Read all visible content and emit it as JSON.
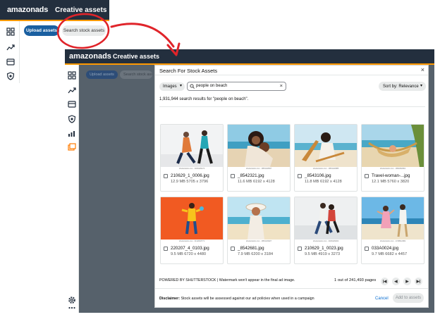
{
  "top_app": {
    "logo": "amazonads",
    "title": "Creative assets",
    "upload_label": "Upload assets",
    "search_label": "Search stock assets"
  },
  "big_app": {
    "logo": "amazonads",
    "title": "Creative assets",
    "upload_label": "Upload assets",
    "search_label": "Search stock assets"
  },
  "modal": {
    "title": "Search For Stock Assets",
    "close_label": "×",
    "type_select": "Images",
    "search_value": "people on beach",
    "clear_label": "×",
    "sort_label": "Sort by: Relevance",
    "results_text": "1,931,944 search results for \"people on beach\".",
    "items": [
      {
        "name": "210629_1_0006.jpg",
        "meta": "12.9 MB 5705 x 3796",
        "watermark": "shutterstock.com · 2026429174"
      },
      {
        "name": "_8542321.jpg",
        "meta": "11.6 MB 6192 x 4128",
        "watermark": "shutterstock.com · 1854132847"
      },
      {
        "name": "_8543106.jpg",
        "meta": "11.8 MB 6192 x 4128",
        "watermark": "shutterstock.com · 1854132985"
      },
      {
        "name": "Travel-woman-...jpg",
        "meta": "12.1 MB 5760 x 3820",
        "watermark": "shutterstock.com · 1890462961"
      },
      {
        "name": "220207_4_0103.jpg",
        "meta": "9.5 MB 6720 x 4480",
        "watermark": "shutterstock.com · 2132618771"
      },
      {
        "name": "_8542681.jpg",
        "meta": "7.9 MB 6200 x 3184",
        "watermark": "shutterstock.com · 1854133027"
      },
      {
        "name": "210629_1_0023.jpg",
        "meta": "9.5 MB 4919 x 3273",
        "watermark": "shutterstock.com · 2026429202"
      },
      {
        "name": "033A0024.jpg",
        "meta": "9.7 MB 6682 x 4457",
        "watermark": "shutterstock.com · 1748512082"
      }
    ],
    "powered_text": "POWERED BY SHUTTERSTOCK | Watermark won't appear in the final ad image.",
    "pages_text": "1 out of 241,493 pages",
    "pager": {
      "first": "|◀",
      "prev": "◀",
      "next": "▶",
      "last": "▶|"
    },
    "disclaimer_label": "Disclaimer:",
    "disclaimer_text": "Stock assets will be assessed against our ad policies when used in a campaign",
    "cancel_label": "Cancel",
    "add_label": "Add to assets"
  },
  "colors": {
    "header_bg": "#232f3e",
    "accent_orange": "#ff9900",
    "primary_blue": "#1a5fa0",
    "annotation_red": "#e0242a",
    "overlay": "#56616b"
  },
  "icons": {
    "sidebar": [
      "dashboard-icon",
      "trend-icon",
      "card-icon",
      "shield-icon",
      "bar-chart-icon",
      "creative-assets-icon",
      "settings-icon",
      "more-icon"
    ]
  }
}
